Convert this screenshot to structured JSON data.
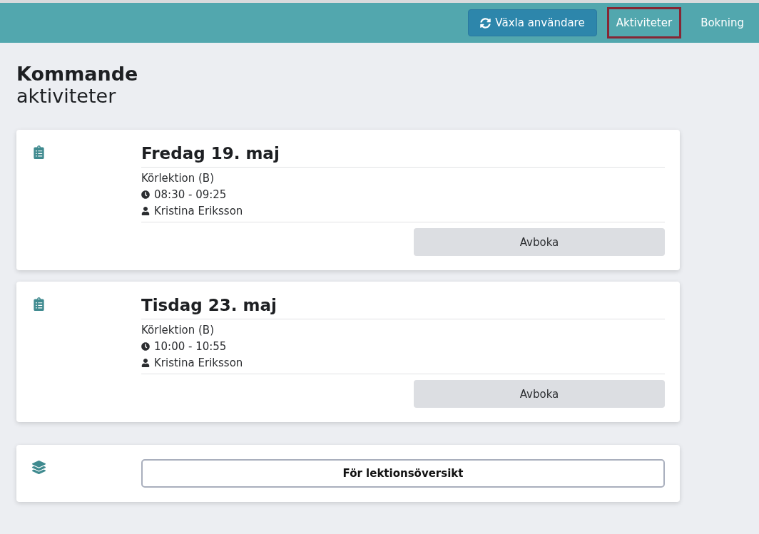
{
  "header": {
    "switch_user": "Växla användare",
    "nav": [
      {
        "label": "Aktiviteter",
        "selected": true
      },
      {
        "label": "Bokning",
        "selected": false
      }
    ]
  },
  "heading": {
    "title": "Kommande",
    "subtitle": "aktiviteter"
  },
  "activities": [
    {
      "date": "Fredag 19. maj",
      "type": "Körlektion (B)",
      "time": "08:30 - 09:25",
      "instructor": "Kristina Eriksson",
      "action": "Avboka"
    },
    {
      "date": "Tisdag 23. maj",
      "type": "Körlektion (B)",
      "time": "10:00 - 10:55",
      "instructor": "Kristina Eriksson",
      "action": "Avboka"
    }
  ],
  "overview": {
    "button": "För lektionsöversikt"
  }
}
